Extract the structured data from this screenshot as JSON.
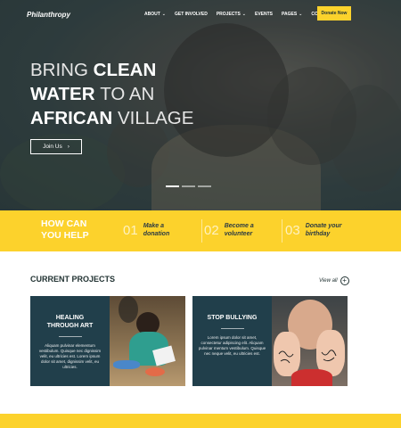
{
  "header": {
    "logo": "Philanthropy",
    "nav": [
      {
        "label": "ABOUT",
        "caret": true
      },
      {
        "label": "GET INVOLVED",
        "caret": false
      },
      {
        "label": "PROJECTS",
        "caret": true
      },
      {
        "label": "EVENTS",
        "caret": false
      },
      {
        "label": "PAGES",
        "caret": true
      },
      {
        "label": "CONTACT",
        "caret": false
      }
    ],
    "donate_label": "Donate Now"
  },
  "hero": {
    "line1_thin": "BRING",
    "line1_bold": "CLEAN",
    "line2_bold": "WATER",
    "line2_thin": "TO AN",
    "line3_bold": "AFRICAN",
    "line3_thin": "VILLAGE",
    "button_label": "Join Us",
    "button_arrow": "›",
    "slides": 3,
    "active_slide": 1
  },
  "help": {
    "title_line1": "HOW CAN",
    "title_line2": "YOU HELP",
    "items": [
      {
        "num": "01",
        "line1": "Make a",
        "line2": "donation"
      },
      {
        "num": "02",
        "line1": "Become a",
        "line2": "volunteer"
      },
      {
        "num": "03",
        "line1": "Donate your",
        "line2": "birthday"
      }
    ]
  },
  "projects": {
    "heading": "CURRENT PROJECTS",
    "view_all": "View all",
    "view_all_icon": "+",
    "cards": [
      {
        "title_line1": "HEALING",
        "title_line2": "THROUGH ART",
        "text": "Aliquam pulvinar elementum vestibulum. Quisque nec dignissim velit, eu ultricies est. Lorem ipsum dolor sit amet, dignissim velit, eu ultricies."
      },
      {
        "title_line1": "STOP BULLYING",
        "title_line2": "",
        "text": "Lorem ipsum dolor sit amet, consectetur adipiscing elit. Aliquam pulvinar mentum vestibulum. Quisque nec neque velit, eu ultricies est."
      }
    ]
  },
  "colors": {
    "accent": "#fcd22c",
    "panel": "#213f4b",
    "text_dark": "#233344"
  }
}
